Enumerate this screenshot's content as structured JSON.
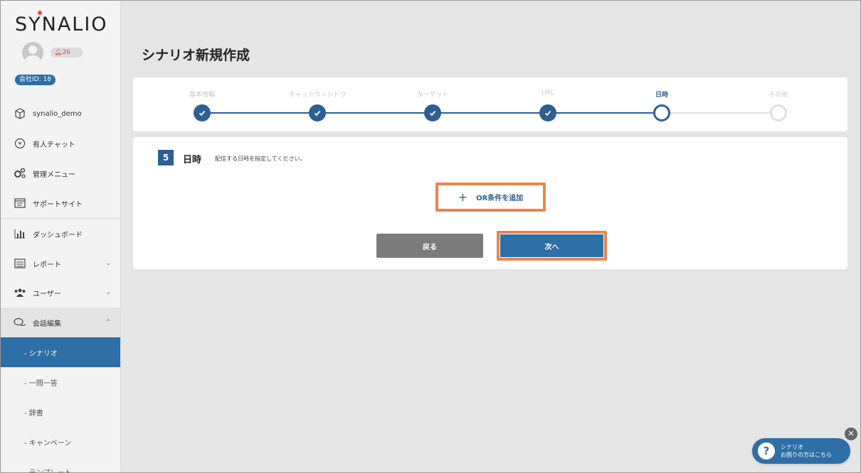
{
  "brand": {
    "logo_text": "SYNALIO",
    "logo_dot_color": "#e74c3c"
  },
  "user": {
    "notification_count": "26",
    "company_id": "会社ID: 18"
  },
  "sidebar": {
    "items": [
      {
        "label": "synalio_demo",
        "icon": "cube-icon"
      },
      {
        "label": "有人チャット",
        "icon": "headset-icon"
      },
      {
        "label": "管理メニュー",
        "icon": "gears-icon"
      },
      {
        "label": "サポートサイト",
        "icon": "window-icon"
      },
      {
        "label": "ダッシュボード",
        "icon": "bar-chart-icon"
      },
      {
        "label": "レポート",
        "icon": "list-icon",
        "caret": "⌄"
      },
      {
        "label": "ユーザー",
        "icon": "users-icon",
        "caret": "⌄"
      },
      {
        "label": "会話編集",
        "icon": "chat-bubbles-icon",
        "caret": "^"
      }
    ],
    "sub_items": [
      {
        "label": "- シナリオ",
        "active": true
      },
      {
        "label": "- 一問一答"
      },
      {
        "label": "- 辞書"
      },
      {
        "label": "- キャンペーン"
      },
      {
        "label": "- テンプレート"
      }
    ]
  },
  "main": {
    "title": "シナリオ新規作成",
    "steps": [
      {
        "label": "基本情報",
        "state": "done"
      },
      {
        "label": "チャットウィンドウ",
        "state": "done"
      },
      {
        "label": "ターゲット",
        "state": "done"
      },
      {
        "label": "URL",
        "state": "done"
      },
      {
        "label": "日時",
        "state": "current"
      },
      {
        "label": "その他",
        "state": "todo"
      }
    ],
    "section": {
      "number": "5",
      "title": "日時",
      "description": "配信する日時を指定してください。"
    },
    "add_or_button": {
      "icon": "+",
      "label": "OR条件を追加"
    },
    "back_button": "戻る",
    "next_button": "次へ"
  },
  "help_widget": {
    "icon": "?",
    "line1": "シナリオ",
    "line2": "お困りの方はこちら",
    "close": "✕"
  },
  "colors": {
    "primary": "#2d6fa6",
    "step_blue": "#2d5f92",
    "highlight": "#e8844f",
    "back_grey": "#7b7b7b"
  }
}
